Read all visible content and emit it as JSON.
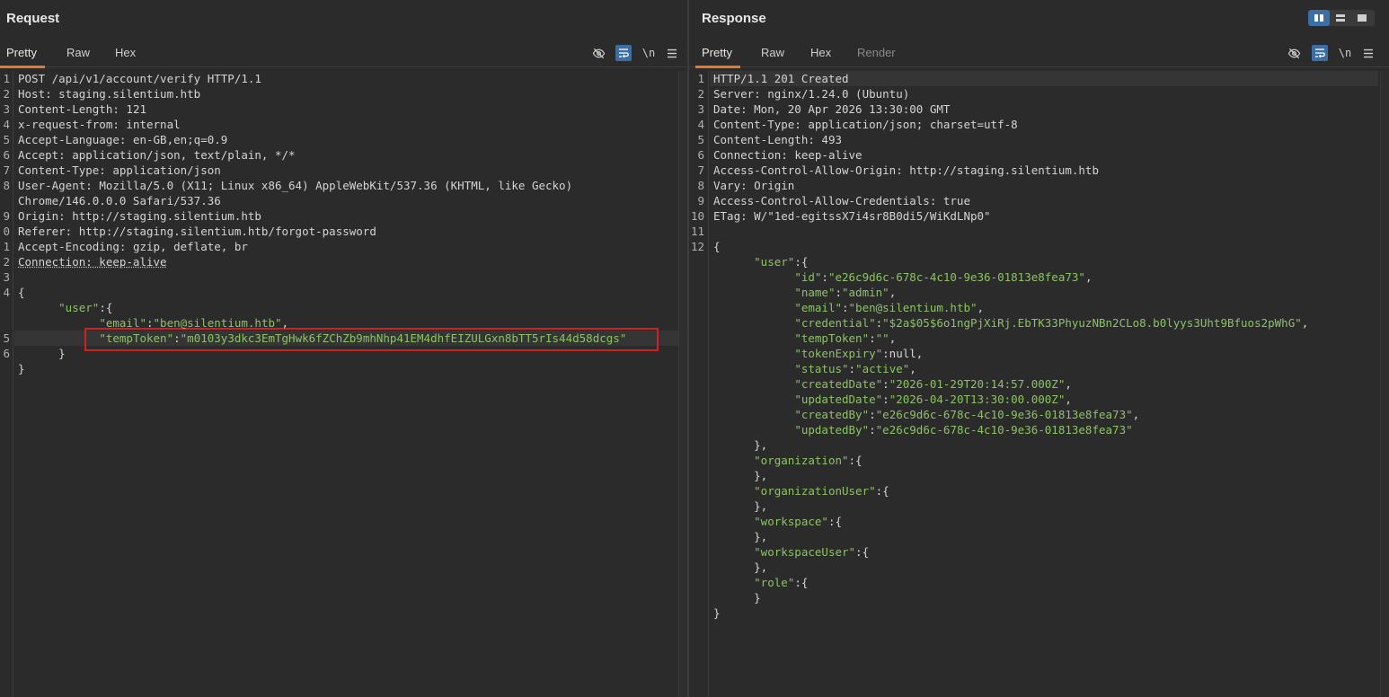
{
  "request": {
    "title": "Request",
    "tabs": [
      "Pretty",
      "Raw",
      "Hex"
    ],
    "active_tab": "Pretty",
    "newline_label": "\\n",
    "lines": [
      {
        "n": "1",
        "parts": [
          {
            "t": "POST /api/v1/account/verify HTTP/1.1",
            "c": "v"
          }
        ]
      },
      {
        "n": "2",
        "parts": [
          {
            "t": "Host: ",
            "c": "k"
          },
          {
            "t": "staging.silentium.htb",
            "c": "v"
          }
        ]
      },
      {
        "n": "3",
        "parts": [
          {
            "t": "Content-Length: ",
            "c": "k"
          },
          {
            "t": "121",
            "c": "v"
          }
        ]
      },
      {
        "n": "4",
        "parts": [
          {
            "t": "x-request-from: ",
            "c": "k"
          },
          {
            "t": "internal",
            "c": "v"
          }
        ]
      },
      {
        "n": "5",
        "parts": [
          {
            "t": "Accept-Language: ",
            "c": "k"
          },
          {
            "t": "en-GB,en;q=0.9",
            "c": "v"
          }
        ]
      },
      {
        "n": "6",
        "parts": [
          {
            "t": "Accept: ",
            "c": "k"
          },
          {
            "t": "application/json, text/plain, */*",
            "c": "v"
          }
        ]
      },
      {
        "n": "7",
        "parts": [
          {
            "t": "Content-Type: ",
            "c": "k"
          },
          {
            "t": "application/json",
            "c": "v"
          }
        ]
      },
      {
        "n": "8",
        "parts": [
          {
            "t": "User-Agent: ",
            "c": "k"
          },
          {
            "t": "Mozilla/5.0 (X11; Linux x86_64) AppleWebKit/537.36 (KHTML, like Gecko)",
            "c": "v"
          }
        ]
      },
      {
        "n": "",
        "parts": [
          {
            "t": "Chrome/146.0.0.0 Safari/537.36",
            "c": "v"
          }
        ]
      },
      {
        "n": "9",
        "parts": [
          {
            "t": "Origin: ",
            "c": "k"
          },
          {
            "t": "http://staging.silentium.htb",
            "c": "v"
          }
        ]
      },
      {
        "n": "0",
        "parts": [
          {
            "t": "Referer: ",
            "c": "k"
          },
          {
            "t": "http://staging.silentium.htb/forgot-password",
            "c": "v"
          }
        ]
      },
      {
        "n": "1",
        "parts": [
          {
            "t": "Accept-Encoding: ",
            "c": "k"
          },
          {
            "t": "gzip, deflate, br",
            "c": "v"
          }
        ]
      },
      {
        "n": "2",
        "parts": [
          {
            "t": "Connection: keep-alive",
            "c": "dotted"
          }
        ]
      },
      {
        "n": "3",
        "parts": []
      },
      {
        "n": "4",
        "parts": [
          {
            "t": "{",
            "c": "p"
          }
        ]
      },
      {
        "n": "",
        "parts": [
          {
            "t": "      ",
            "c": "p"
          },
          {
            "t": "\"user\"",
            "c": "key"
          },
          {
            "t": ":{",
            "c": "p"
          }
        ]
      },
      {
        "n": "",
        "parts": [
          {
            "t": "            ",
            "c": "p"
          },
          {
            "t": "\"email\"",
            "c": "key"
          },
          {
            "t": ":",
            "c": "p"
          },
          {
            "t": "\"ben@silentium.htb\"",
            "c": "s"
          },
          {
            "t": ",",
            "c": "p"
          }
        ]
      },
      {
        "n": "5",
        "parts": [
          {
            "t": "            ",
            "c": "p"
          },
          {
            "t": "\"tempToken\"",
            "c": "key"
          },
          {
            "t": ":",
            "c": "p"
          },
          {
            "t": "\"m0103y3dkc3EmTgHwk6fZChZb9mhNhp41EM4dhfEIZULGxn8bTT5rIs44d58dcgs\"",
            "c": "s"
          }
        ]
      },
      {
        "n": "6",
        "parts": [
          {
            "t": "      }",
            "c": "p"
          }
        ]
      },
      {
        "n": "",
        "parts": [
          {
            "t": "}",
            "c": "p"
          }
        ]
      }
    ]
  },
  "response": {
    "title": "Response",
    "tabs": [
      "Pretty",
      "Raw",
      "Hex",
      "Render"
    ],
    "active_tab": "Pretty",
    "newline_label": "\\n",
    "lines": [
      {
        "n": "1",
        "parts": [
          {
            "t": "HTTP/1.1 201 Created",
            "c": "v"
          }
        ]
      },
      {
        "n": "2",
        "parts": [
          {
            "t": "Server: ",
            "c": "k"
          },
          {
            "t": "nginx/1.24.0 (Ubuntu)",
            "c": "v"
          }
        ]
      },
      {
        "n": "3",
        "parts": [
          {
            "t": "Date: ",
            "c": "k"
          },
          {
            "t": "Mon, 20 Apr 2026 13:30:00 GMT",
            "c": "v"
          }
        ]
      },
      {
        "n": "4",
        "parts": [
          {
            "t": "Content-Type: ",
            "c": "k"
          },
          {
            "t": "application/json; charset=utf-8",
            "c": "v"
          }
        ]
      },
      {
        "n": "5",
        "parts": [
          {
            "t": "Content-Length: ",
            "c": "k"
          },
          {
            "t": "493",
            "c": "v"
          }
        ]
      },
      {
        "n": "6",
        "parts": [
          {
            "t": "Connection: ",
            "c": "k"
          },
          {
            "t": "keep-alive",
            "c": "v"
          }
        ]
      },
      {
        "n": "7",
        "parts": [
          {
            "t": "Access-Control-Allow-Origin: ",
            "c": "k"
          },
          {
            "t": "http://staging.silentium.htb",
            "c": "v"
          }
        ]
      },
      {
        "n": "8",
        "parts": [
          {
            "t": "Vary: ",
            "c": "k"
          },
          {
            "t": "Origin",
            "c": "v"
          }
        ]
      },
      {
        "n": "9",
        "parts": [
          {
            "t": "Access-Control-Allow-Credentials: ",
            "c": "k"
          },
          {
            "t": "true",
            "c": "v"
          }
        ]
      },
      {
        "n": "10",
        "parts": [
          {
            "t": "ETag: ",
            "c": "k"
          },
          {
            "t": "W/\"1ed-egitssX7i4sr8B0di5/WiKdLNp0\"",
            "c": "v"
          }
        ]
      },
      {
        "n": "11",
        "parts": []
      },
      {
        "n": "12",
        "parts": [
          {
            "t": "{",
            "c": "p"
          }
        ]
      },
      {
        "n": "",
        "parts": [
          {
            "t": "      ",
            "c": "p"
          },
          {
            "t": "\"user\"",
            "c": "key"
          },
          {
            "t": ":{",
            "c": "p"
          }
        ]
      },
      {
        "n": "",
        "parts": [
          {
            "t": "            ",
            "c": "p"
          },
          {
            "t": "\"id\"",
            "c": "key"
          },
          {
            "t": ":",
            "c": "p"
          },
          {
            "t": "\"e26c9d6c-678c-4c10-9e36-01813e8fea73\"",
            "c": "s"
          },
          {
            "t": ",",
            "c": "p"
          }
        ]
      },
      {
        "n": "",
        "parts": [
          {
            "t": "            ",
            "c": "p"
          },
          {
            "t": "\"name\"",
            "c": "key"
          },
          {
            "t": ":",
            "c": "p"
          },
          {
            "t": "\"admin\"",
            "c": "s"
          },
          {
            "t": ",",
            "c": "p"
          }
        ]
      },
      {
        "n": "",
        "parts": [
          {
            "t": "            ",
            "c": "p"
          },
          {
            "t": "\"email\"",
            "c": "key"
          },
          {
            "t": ":",
            "c": "p"
          },
          {
            "t": "\"ben@silentium.htb\"",
            "c": "s"
          },
          {
            "t": ",",
            "c": "p"
          }
        ]
      },
      {
        "n": "",
        "parts": [
          {
            "t": "            ",
            "c": "p"
          },
          {
            "t": "\"credential\"",
            "c": "key"
          },
          {
            "t": ":",
            "c": "p"
          },
          {
            "t": "\"$2a$05$6o1ngPjXiRj.EbTK33PhyuzNBn2CLo8.b0lyys3Uht9Bfuos2pWhG\"",
            "c": "s"
          },
          {
            "t": ",",
            "c": "p"
          }
        ]
      },
      {
        "n": "",
        "parts": [
          {
            "t": "            ",
            "c": "p"
          },
          {
            "t": "\"tempToken\"",
            "c": "key"
          },
          {
            "t": ":",
            "c": "p"
          },
          {
            "t": "\"\"",
            "c": "s"
          },
          {
            "t": ",",
            "c": "p"
          }
        ]
      },
      {
        "n": "",
        "parts": [
          {
            "t": "            ",
            "c": "p"
          },
          {
            "t": "\"tokenExpiry\"",
            "c": "key"
          },
          {
            "t": ":null,",
            "c": "p"
          }
        ]
      },
      {
        "n": "",
        "parts": [
          {
            "t": "            ",
            "c": "p"
          },
          {
            "t": "\"status\"",
            "c": "key"
          },
          {
            "t": ":",
            "c": "p"
          },
          {
            "t": "\"active\"",
            "c": "s"
          },
          {
            "t": ",",
            "c": "p"
          }
        ]
      },
      {
        "n": "",
        "parts": [
          {
            "t": "            ",
            "c": "p"
          },
          {
            "t": "\"createdDate\"",
            "c": "key"
          },
          {
            "t": ":",
            "c": "p"
          },
          {
            "t": "\"2026-01-29T20:14:57.000Z\"",
            "c": "s"
          },
          {
            "t": ",",
            "c": "p"
          }
        ]
      },
      {
        "n": "",
        "parts": [
          {
            "t": "            ",
            "c": "p"
          },
          {
            "t": "\"updatedDate\"",
            "c": "key"
          },
          {
            "t": ":",
            "c": "p"
          },
          {
            "t": "\"2026-04-20T13:30:00.000Z\"",
            "c": "s"
          },
          {
            "t": ",",
            "c": "p"
          }
        ]
      },
      {
        "n": "",
        "parts": [
          {
            "t": "            ",
            "c": "p"
          },
          {
            "t": "\"createdBy\"",
            "c": "key"
          },
          {
            "t": ":",
            "c": "p"
          },
          {
            "t": "\"e26c9d6c-678c-4c10-9e36-01813e8fea73\"",
            "c": "s"
          },
          {
            "t": ",",
            "c": "p"
          }
        ]
      },
      {
        "n": "",
        "parts": [
          {
            "t": "            ",
            "c": "p"
          },
          {
            "t": "\"updatedBy\"",
            "c": "key"
          },
          {
            "t": ":",
            "c": "p"
          },
          {
            "t": "\"e26c9d6c-678c-4c10-9e36-01813e8fea73\"",
            "c": "s"
          }
        ]
      },
      {
        "n": "",
        "parts": [
          {
            "t": "      },",
            "c": "p"
          }
        ]
      },
      {
        "n": "",
        "parts": [
          {
            "t": "      ",
            "c": "p"
          },
          {
            "t": "\"organization\"",
            "c": "key"
          },
          {
            "t": ":{",
            "c": "p"
          }
        ]
      },
      {
        "n": "",
        "parts": [
          {
            "t": "      },",
            "c": "p"
          }
        ]
      },
      {
        "n": "",
        "parts": [
          {
            "t": "      ",
            "c": "p"
          },
          {
            "t": "\"organizationUser\"",
            "c": "key"
          },
          {
            "t": ":{",
            "c": "p"
          }
        ]
      },
      {
        "n": "",
        "parts": [
          {
            "t": "      },",
            "c": "p"
          }
        ]
      },
      {
        "n": "",
        "parts": [
          {
            "t": "      ",
            "c": "p"
          },
          {
            "t": "\"workspace\"",
            "c": "key"
          },
          {
            "t": ":{",
            "c": "p"
          }
        ]
      },
      {
        "n": "",
        "parts": [
          {
            "t": "      },",
            "c": "p"
          }
        ]
      },
      {
        "n": "",
        "parts": [
          {
            "t": "      ",
            "c": "p"
          },
          {
            "t": "\"workspaceUser\"",
            "c": "key"
          },
          {
            "t": ":{",
            "c": "p"
          }
        ]
      },
      {
        "n": "",
        "parts": [
          {
            "t": "      },",
            "c": "p"
          }
        ]
      },
      {
        "n": "",
        "parts": [
          {
            "t": "      ",
            "c": "p"
          },
          {
            "t": "\"role\"",
            "c": "key"
          },
          {
            "t": ":{",
            "c": "p"
          }
        ]
      },
      {
        "n": "",
        "parts": [
          {
            "t": "      }",
            "c": "p"
          }
        ]
      },
      {
        "n": "",
        "parts": [
          {
            "t": "}",
            "c": "p"
          }
        ]
      }
    ]
  },
  "icons": {
    "hide": "eye-off-icon",
    "wrap": "word-wrap-icon",
    "newline": "newline-toggle-icon",
    "menu": "hamburger-menu-icon"
  },
  "colors": {
    "accent_tab": "#e8772e",
    "toggle_active": "#3a6ea5",
    "json_string": "#8cc265",
    "highlight_box": "#d0201f"
  }
}
